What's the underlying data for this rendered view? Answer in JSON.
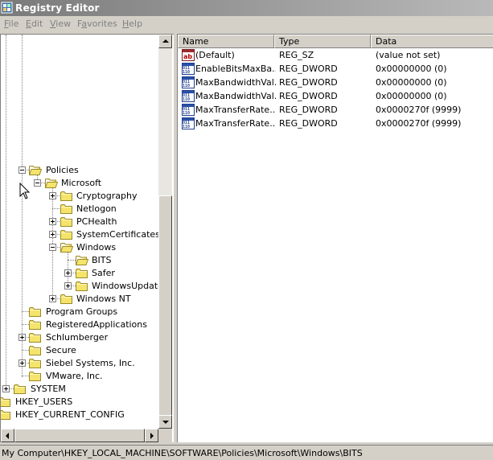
{
  "window": {
    "title": "Registry Editor"
  },
  "menu": {
    "file": {
      "mnem": "F",
      "rest": "ile"
    },
    "edit": {
      "mnem": "E",
      "rest": "dit"
    },
    "view": {
      "mnem": "V",
      "rest": "iew"
    },
    "favorites": {
      "pre": "F",
      "mnem": "a",
      "rest": "vorites"
    },
    "help": {
      "mnem": "H",
      "rest": "elp"
    }
  },
  "tree": {
    "policies": "Policies",
    "microsoft": "Microsoft",
    "cryptography": "Cryptography",
    "netlogon": "Netlogon",
    "pchealth": "PCHealth",
    "systemcertificates": "SystemCertificates",
    "windows": "Windows",
    "bits": "BITS",
    "safer": "Safer",
    "windowsupdate": "WindowsUpdate",
    "windowsnt": "Windows NT",
    "programgroups": "Program Groups",
    "registeredapplications": "RegisteredApplications",
    "schlumberger": "Schlumberger",
    "secure": "Secure",
    "siebel": "Siebel Systems, Inc.",
    "vmware": "VMware, Inc.",
    "system": "SYSTEM",
    "hkey_users": "HKEY_USERS",
    "hkey_current_config": "HKEY_CURRENT_CONFIG"
  },
  "list": {
    "headers": {
      "name": "Name",
      "type": "Type",
      "data": "Data"
    },
    "rows": [
      {
        "name": "(Default)",
        "type": "REG_SZ",
        "data": "(value not set)",
        "icon": "string-value-icon"
      },
      {
        "name": "EnableBitsMaxBa...",
        "type": "REG_DWORD",
        "data": "0x00000000 (0)",
        "icon": "dword-value-icon"
      },
      {
        "name": "MaxBandwidthVal...",
        "type": "REG_DWORD",
        "data": "0x00000000 (0)",
        "icon": "dword-value-icon"
      },
      {
        "name": "MaxBandwidthVal...",
        "type": "REG_DWORD",
        "data": "0x00000000 (0)",
        "icon": "dword-value-icon"
      },
      {
        "name": "MaxTransferRate...",
        "type": "REG_DWORD",
        "data": "0x0000270f (9999)",
        "icon": "dword-value-icon"
      },
      {
        "name": "MaxTransferRate...",
        "type": "REG_DWORD",
        "data": "0x0000270f (9999)",
        "icon": "dword-value-icon"
      }
    ]
  },
  "status": {
    "path": "My Computer\\HKEY_LOCAL_MACHINE\\SOFTWARE\\Policies\\Microsoft\\Windows\\BITS"
  },
  "colors": {
    "folder": "#f5e46b",
    "folder_edge": "#9a8a2a",
    "title_grad_start": "#7a7a7a",
    "title_grad_end": "#b9b9b9"
  }
}
